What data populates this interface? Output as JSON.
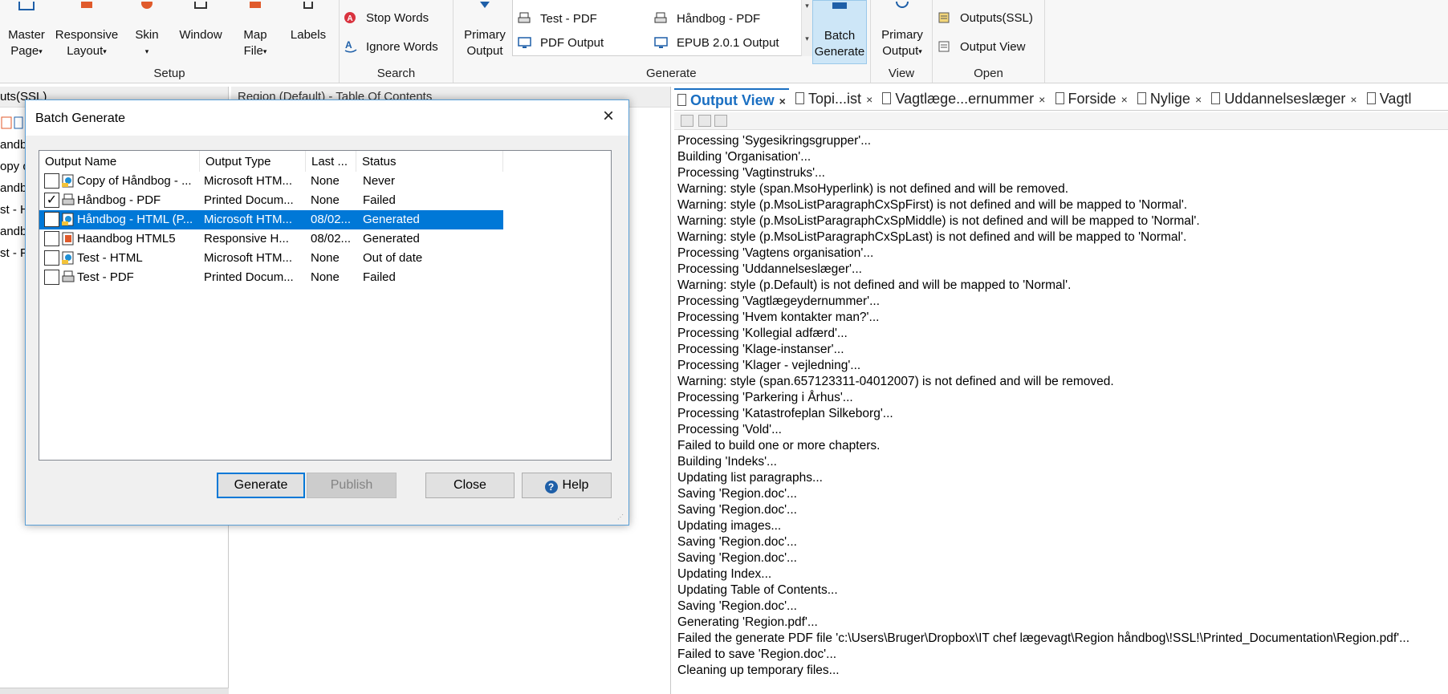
{
  "ribbon": {
    "setup": {
      "label": "Setup",
      "buttons": [
        {
          "l1": "Master",
          "l2": "Page"
        },
        {
          "l1": "Responsive",
          "l2": "Layout"
        },
        {
          "l1": "Skin",
          "l2": ""
        },
        {
          "l1": "Window",
          "l2": ""
        },
        {
          "l1": "Map",
          "l2": "File"
        },
        {
          "l1": "Labels",
          "l2": ""
        }
      ]
    },
    "search": {
      "label": "Search",
      "stop_words": "Stop Words",
      "ignore_words": "Ignore Words"
    },
    "generate": {
      "label": "Generate",
      "primary_output": {
        "l1": "Primary",
        "l2": "Output"
      },
      "list_items": [
        "Test - PDF",
        "Håndbog  - PDF",
        "PDF Output",
        "EPUB 2.0.1 Output"
      ],
      "batch_generate": {
        "l1": "Batch",
        "l2": "Generate"
      }
    },
    "view": {
      "label": "View",
      "primary_output": {
        "l1": "Primary",
        "l2": "Output"
      }
    },
    "open": {
      "label": "Open",
      "outputs_ssl": "Outputs(SSL)",
      "output_view": "Output View"
    }
  },
  "left_pane": {
    "title": "uts(SSL)",
    "rows": [
      "andb",
      "opy of",
      "andbo",
      "st - H",
      "andbo",
      "st - F"
    ]
  },
  "mid_pane": {
    "title": "Region (Default) - Table Of Contents"
  },
  "output_view": {
    "tabs": [
      {
        "label": "Output View",
        "active": true
      },
      {
        "label": "Topi...ist",
        "active": false
      },
      {
        "label": "Vagtlæge...ernummer",
        "active": false
      },
      {
        "label": "Forside",
        "active": false
      },
      {
        "label": "Nylige",
        "active": false
      },
      {
        "label": "Uddannelseslæger",
        "active": false
      },
      {
        "label": "Vagtl",
        "active": false
      }
    ],
    "log": [
      "Processing 'Sygesikringsgrupper'...",
      "Building 'Organisation'...",
      "Processing 'Vagtinstruks'...",
      "Warning: style (span.MsoHyperlink) is not defined and will be removed.",
      "Warning: style (p.MsoListParagraphCxSpFirst) is not defined and will be mapped to 'Normal'.",
      "Warning: style (p.MsoListParagraphCxSpMiddle) is not defined and will be mapped to 'Normal'.",
      "Warning: style (p.MsoListParagraphCxSpLast) is not defined and will be mapped to 'Normal'.",
      "Processing 'Vagtens organisation'...",
      "Processing 'Uddannelseslæger'...",
      "Warning: style (p.Default) is not defined and will be mapped to 'Normal'.",
      "Processing 'Vagtlægeydernummer'...",
      "Processing 'Hvem kontakter man?'...",
      "Processing 'Kollegial adfærd'...",
      "Processing 'Klage-instanser'...",
      "Processing 'Klager - vejledning'...",
      "Warning: style (span.657123311-04012007) is not defined and will be removed.",
      "Processing 'Parkering i Århus'...",
      "Processing 'Katastrofeplan Silkeborg'...",
      "Processing 'Vold'...",
      "Failed to build one or more chapters.",
      "Building 'Indeks'...",
      "Updating list paragraphs...",
      "Saving 'Region.doc'...",
      "Saving 'Region.doc'...",
      "Updating images...",
      "Saving 'Region.doc'...",
      "Saving 'Region.doc'...",
      "Updating Index...",
      "Updating Table of Contents...",
      "Saving 'Region.doc'...",
      "Generating 'Region.pdf'...",
      "Failed the generate PDF file 'c:\\Users\\Bruger\\Dropbox\\IT chef lægevagt\\Region håndbog\\!SSL!\\Printed_Documentation\\Region.pdf'...",
      "Failed to save 'Region.doc'...",
      "Cleaning up temporary files..."
    ]
  },
  "dialog": {
    "title": "Batch Generate",
    "columns": [
      "Output Name",
      "Output Type",
      "Last ...",
      "Status"
    ],
    "rows": [
      {
        "checked": false,
        "name": "Copy of Håndbog - ...",
        "type": "Microsoft HTM...",
        "last": "None",
        "status": "Never",
        "selected": false,
        "icon": "html-output-icon"
      },
      {
        "checked": true,
        "name": "Håndbog  - PDF",
        "type": "Printed Docum...",
        "last": "None",
        "status": "Failed",
        "selected": false,
        "icon": "printed-output-icon"
      },
      {
        "checked": false,
        "name": "Håndbog - HTML (P...",
        "type": "Microsoft HTM...",
        "last": "08/02...",
        "status": "Generated",
        "selected": true,
        "icon": "html-output-icon"
      },
      {
        "checked": false,
        "name": "Haandbog HTML5",
        "type": "Responsive H...",
        "last": "08/02...",
        "status": "Generated",
        "selected": false,
        "icon": "html5-output-icon"
      },
      {
        "checked": false,
        "name": "Test - HTML",
        "type": "Microsoft HTM...",
        "last": "None",
        "status": "Out of date",
        "selected": false,
        "icon": "html-output-icon"
      },
      {
        "checked": false,
        "name": "Test - PDF",
        "type": "Printed Docum...",
        "last": "None",
        "status": "Failed",
        "selected": false,
        "icon": "printed-output-icon"
      }
    ],
    "buttons": {
      "generate": "Generate",
      "publish": "Publish",
      "close": "Close",
      "help": "Help"
    }
  },
  "colors": {
    "selection": "#0078d7",
    "tab_active": "#1a6fc2",
    "ribbon_bg": "#f7f7f7"
  }
}
